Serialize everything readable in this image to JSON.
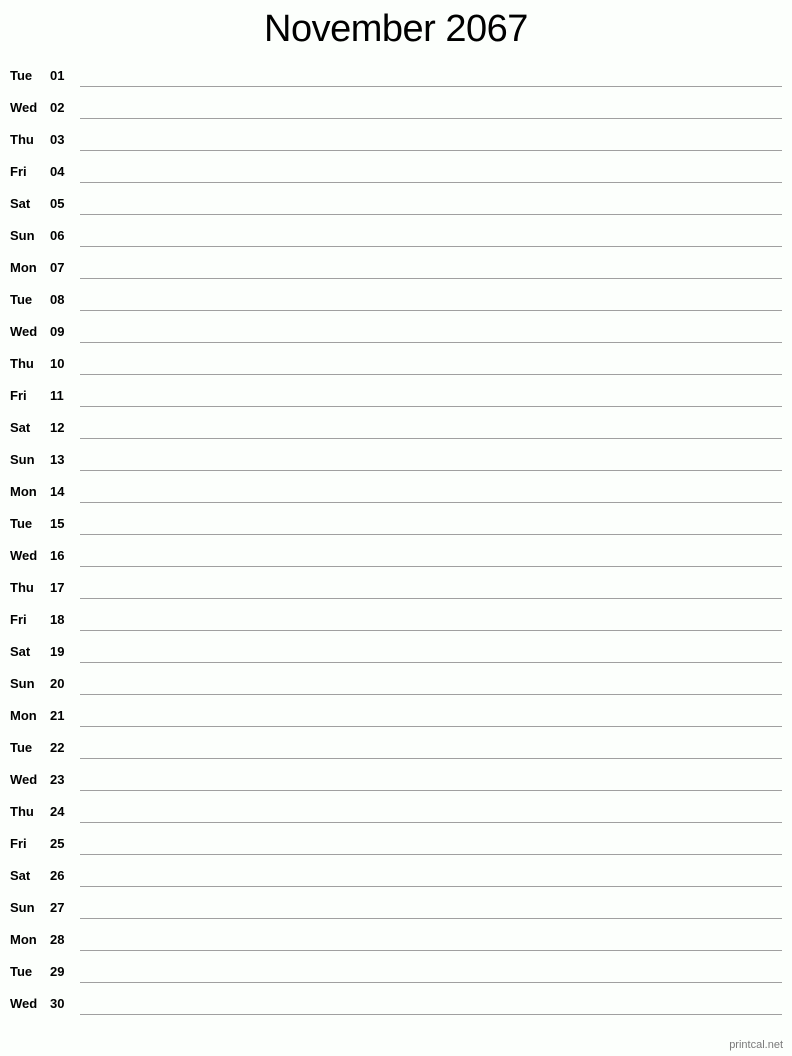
{
  "title": "November 2067",
  "days": [
    {
      "dow": "Tue",
      "num": "01"
    },
    {
      "dow": "Wed",
      "num": "02"
    },
    {
      "dow": "Thu",
      "num": "03"
    },
    {
      "dow": "Fri",
      "num": "04"
    },
    {
      "dow": "Sat",
      "num": "05"
    },
    {
      "dow": "Sun",
      "num": "06"
    },
    {
      "dow": "Mon",
      "num": "07"
    },
    {
      "dow": "Tue",
      "num": "08"
    },
    {
      "dow": "Wed",
      "num": "09"
    },
    {
      "dow": "Thu",
      "num": "10"
    },
    {
      "dow": "Fri",
      "num": "11"
    },
    {
      "dow": "Sat",
      "num": "12"
    },
    {
      "dow": "Sun",
      "num": "13"
    },
    {
      "dow": "Mon",
      "num": "14"
    },
    {
      "dow": "Tue",
      "num": "15"
    },
    {
      "dow": "Wed",
      "num": "16"
    },
    {
      "dow": "Thu",
      "num": "17"
    },
    {
      "dow": "Fri",
      "num": "18"
    },
    {
      "dow": "Sat",
      "num": "19"
    },
    {
      "dow": "Sun",
      "num": "20"
    },
    {
      "dow": "Mon",
      "num": "21"
    },
    {
      "dow": "Tue",
      "num": "22"
    },
    {
      "dow": "Wed",
      "num": "23"
    },
    {
      "dow": "Thu",
      "num": "24"
    },
    {
      "dow": "Fri",
      "num": "25"
    },
    {
      "dow": "Sat",
      "num": "26"
    },
    {
      "dow": "Sun",
      "num": "27"
    },
    {
      "dow": "Mon",
      "num": "28"
    },
    {
      "dow": "Tue",
      "num": "29"
    },
    {
      "dow": "Wed",
      "num": "30"
    }
  ],
  "footer": "printcal.net",
  "colors": {
    "background": "#fcfffc",
    "rule": "#a0a0a0",
    "footer_text": "#7a7a7a"
  }
}
